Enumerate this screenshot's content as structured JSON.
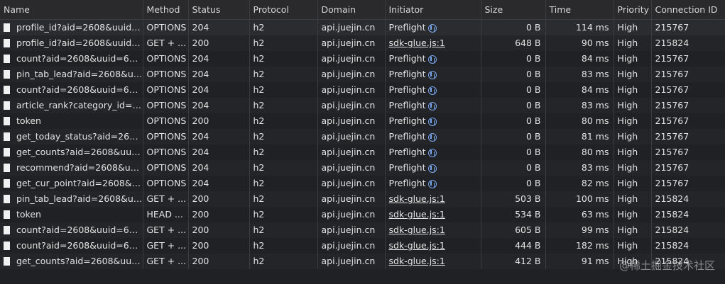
{
  "columns": [
    "Name",
    "Method",
    "Status",
    "Protocol",
    "Domain",
    "Initiator",
    "Size",
    "Time",
    "Priority",
    "Connection ID"
  ],
  "rows": [
    {
      "name": "profile_id?aid=2608&uuid=...",
      "method": "OPTIONS",
      "status": "204",
      "protocol": "h2",
      "domain": "api.juejin.cn",
      "initiator": "Preflight",
      "initiator_type": "preflight",
      "size": "0 B",
      "time": "114 ms",
      "priority": "High",
      "conn": "215767"
    },
    {
      "name": "profile_id?aid=2608&uuid=...",
      "method": "GET + ...",
      "status": "200",
      "protocol": "h2",
      "domain": "api.juejin.cn",
      "initiator": "sdk-glue.js:1",
      "initiator_type": "link",
      "size": "648 B",
      "time": "90 ms",
      "priority": "High",
      "conn": "215824"
    },
    {
      "name": "count?aid=2608&uuid=699...",
      "method": "OPTIONS",
      "status": "204",
      "protocol": "h2",
      "domain": "api.juejin.cn",
      "initiator": "Preflight",
      "initiator_type": "preflight",
      "size": "0 B",
      "time": "84 ms",
      "priority": "High",
      "conn": "215767"
    },
    {
      "name": "pin_tab_lead?aid=2608&uu...",
      "method": "OPTIONS",
      "status": "204",
      "protocol": "h2",
      "domain": "api.juejin.cn",
      "initiator": "Preflight",
      "initiator_type": "preflight",
      "size": "0 B",
      "time": "83 ms",
      "priority": "High",
      "conn": "215767"
    },
    {
      "name": "count?aid=2608&uuid=699...",
      "method": "OPTIONS",
      "status": "204",
      "protocol": "h2",
      "domain": "api.juejin.cn",
      "initiator": "Preflight",
      "initiator_type": "preflight",
      "size": "0 B",
      "time": "84 ms",
      "priority": "High",
      "conn": "215767"
    },
    {
      "name": "article_rank?category_id=1...",
      "method": "OPTIONS",
      "status": "204",
      "protocol": "h2",
      "domain": "api.juejin.cn",
      "initiator": "Preflight",
      "initiator_type": "preflight",
      "size": "0 B",
      "time": "83 ms",
      "priority": "High",
      "conn": "215767"
    },
    {
      "name": "token",
      "method": "OPTIONS",
      "status": "200",
      "protocol": "h2",
      "domain": "api.juejin.cn",
      "initiator": "Preflight",
      "initiator_type": "preflight",
      "size": "0 B",
      "time": "80 ms",
      "priority": "High",
      "conn": "215767"
    },
    {
      "name": "get_today_status?aid=2608...",
      "method": "OPTIONS",
      "status": "204",
      "protocol": "h2",
      "domain": "api.juejin.cn",
      "initiator": "Preflight",
      "initiator_type": "preflight",
      "size": "0 B",
      "time": "81 ms",
      "priority": "High",
      "conn": "215767"
    },
    {
      "name": "get_counts?aid=2608&uuid...",
      "method": "OPTIONS",
      "status": "204",
      "protocol": "h2",
      "domain": "api.juejin.cn",
      "initiator": "Preflight",
      "initiator_type": "preflight",
      "size": "0 B",
      "time": "80 ms",
      "priority": "High",
      "conn": "215767"
    },
    {
      "name": "recommend?aid=2608&uui...",
      "method": "OPTIONS",
      "status": "204",
      "protocol": "h2",
      "domain": "api.juejin.cn",
      "initiator": "Preflight",
      "initiator_type": "preflight",
      "size": "0 B",
      "time": "83 ms",
      "priority": "High",
      "conn": "215767"
    },
    {
      "name": "get_cur_point?aid=2608&u...",
      "method": "OPTIONS",
      "status": "204",
      "protocol": "h2",
      "domain": "api.juejin.cn",
      "initiator": "Preflight",
      "initiator_type": "preflight",
      "size": "0 B",
      "time": "82 ms",
      "priority": "High",
      "conn": "215767"
    },
    {
      "name": "pin_tab_lead?aid=2608&uu...",
      "method": "GET + ...",
      "status": "200",
      "protocol": "h2",
      "domain": "api.juejin.cn",
      "initiator": "sdk-glue.js:1",
      "initiator_type": "link",
      "size": "503 B",
      "time": "100 ms",
      "priority": "High",
      "conn": "215824"
    },
    {
      "name": "token",
      "method": "HEAD ...",
      "status": "200",
      "protocol": "h2",
      "domain": "api.juejin.cn",
      "initiator": "sdk-glue.js:1",
      "initiator_type": "link",
      "size": "534 B",
      "time": "63 ms",
      "priority": "High",
      "conn": "215824"
    },
    {
      "name": "count?aid=2608&uuid=699...",
      "method": "GET + ...",
      "status": "200",
      "protocol": "h2",
      "domain": "api.juejin.cn",
      "initiator": "sdk-glue.js:1",
      "initiator_type": "link",
      "size": "605 B",
      "time": "99 ms",
      "priority": "High",
      "conn": "215824"
    },
    {
      "name": "count?aid=2608&uuid=699...",
      "method": "GET + ...",
      "status": "200",
      "protocol": "h2",
      "domain": "api.juejin.cn",
      "initiator": "sdk-glue.js:1",
      "initiator_type": "link",
      "size": "444 B",
      "time": "182 ms",
      "priority": "High",
      "conn": "215824"
    },
    {
      "name": "get_counts?aid=2608&uuid...",
      "method": "GET + ...",
      "status": "200",
      "protocol": "h2",
      "domain": "api.juejin.cn",
      "initiator": "sdk-glue.js:1",
      "initiator_type": "link",
      "size": "412 B",
      "time": "91 ms",
      "priority": "High",
      "conn": "215824"
    }
  ],
  "watermark": "@稀土掘金技术社区",
  "icons": {
    "file": "file-icon",
    "preflight": "preflight-icon"
  },
  "colors": {
    "background": "#202124",
    "header": "#2a2a2d",
    "link": "#e3e3e3",
    "preflight_icon": "#7aa7f0"
  }
}
